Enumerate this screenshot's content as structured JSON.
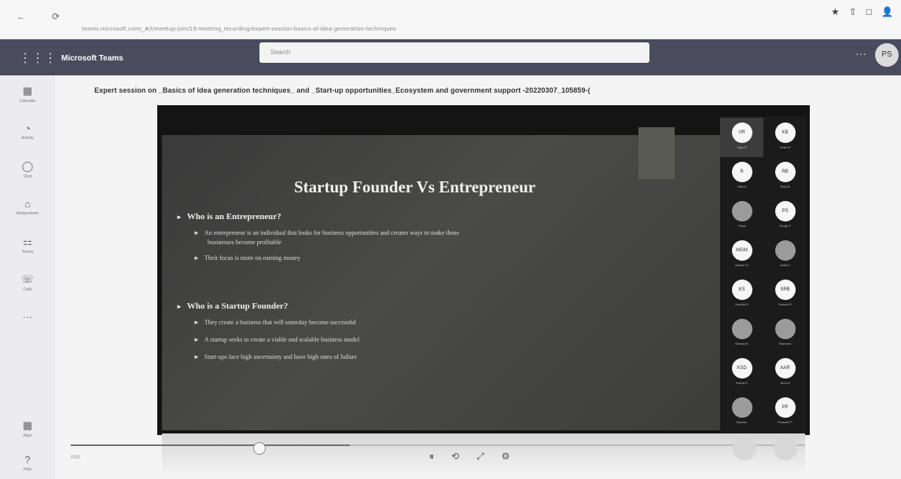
{
  "browser": {
    "back_icon": "←",
    "refresh_icon": "⟳",
    "url": "teams.microsoft.com/_#/l/meetup-join/19:meeting_recording/expert-session-basics-of-idea-generation-techniques",
    "toolbar_icons": [
      "★",
      "⇧",
      "□",
      "👤"
    ]
  },
  "header": {
    "app_name": "Microsoft Teams",
    "search_placeholder": "Search",
    "more_label": "···",
    "avatar_initials": "PS",
    "grid_icon": "⋮⋮⋮"
  },
  "rail": {
    "items": [
      {
        "icon": "▦",
        "label": "Calendar"
      },
      {
        "icon": "◔",
        "label": "Activity"
      },
      {
        "icon": "◯",
        "label": "Chat"
      },
      {
        "icon": "⌂",
        "label": "Assignments"
      },
      {
        "icon": "⚏",
        "label": "Teams"
      },
      {
        "icon": "☏",
        "label": "Calls"
      },
      {
        "icon": "···",
        "label": ""
      },
      {
        "icon": "▦",
        "label": "Apps"
      },
      {
        "icon": "?",
        "label": "Help"
      }
    ]
  },
  "meeting": {
    "title": "Expert session on _Basics of idea generation techniques_ and _Start-up opportunities_Ecosystem and government support -20220307_105859-("
  },
  "slide": {
    "title": "Startup Founder Vs Entrepreneur",
    "sections": [
      {
        "heading": "Who is an Entrepreneur?",
        "points": [
          "An entrepreneur is an individual that looks for business opportunities and creates ways to make those",
          "businesses become profitable",
          "Their focus is more on earning money"
        ]
      },
      {
        "heading": "Who is a Startup Founder?",
        "points": [
          "They create a business that will someday become successful",
          "A startup seeks to create a viable and scalable business model",
          "Start-ups face high uncertainty and have high rates of failure"
        ]
      }
    ]
  },
  "participants": [
    {
      "initials": "VR",
      "name": "Vijay R"
    },
    {
      "initials": "KB",
      "name": "Kiran B"
    },
    {
      "initials": "R",
      "name": "Rahul"
    },
    {
      "initials": "RB",
      "name": "Ravi B"
    },
    {
      "initials": "",
      "name": "Priya"
    },
    {
      "initials": "PS",
      "name": "Pooja S"
    },
    {
      "initials": "MGM",
      "name": "Mohan G"
    },
    {
      "initials": "",
      "name": "Anita K"
    },
    {
      "initials": "KS",
      "name": "Karthik S"
    },
    {
      "initials": "SRB",
      "name": "Suresh R"
    },
    {
      "initials": "",
      "name": "Deepa M"
    },
    {
      "initials": "",
      "name": "Ramesh"
    },
    {
      "initials": "KSD",
      "name": "Kavya D"
    },
    {
      "initials": "AAR",
      "name": "Arun A"
    },
    {
      "initials": "",
      "name": "Naveen"
    },
    {
      "initials": "PP",
      "name": "Prakash P"
    }
  ],
  "player": {
    "progress": 0.38,
    "controls": [
      "⏸",
      "⟲",
      "⤢",
      "⚙"
    ],
    "time": "0:00"
  }
}
